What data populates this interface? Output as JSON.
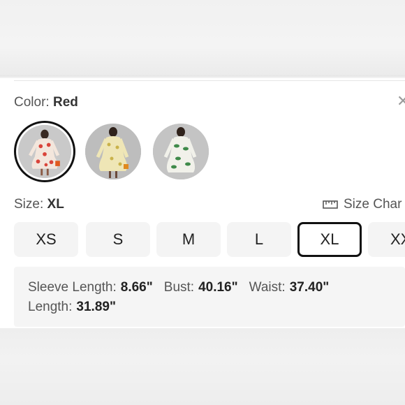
{
  "color": {
    "label": "Color:",
    "value": "Red"
  },
  "swatches": [
    {
      "name": "Red",
      "selected": true
    },
    {
      "name": "Yellow",
      "selected": false
    },
    {
      "name": "Green",
      "selected": false
    }
  ],
  "close_icon": "close-icon",
  "size": {
    "label": "Size:",
    "value": "XL",
    "guide_label": "Size Char",
    "guide_icon": "ruler-icon"
  },
  "sizes": [
    "XS",
    "S",
    "M",
    "L",
    "XL",
    "XX"
  ],
  "selected_size": "XL",
  "measurements": {
    "sleeve_label": "Sleeve Length:",
    "sleeve_value": "8.66\"",
    "bust_label": "Bust:",
    "bust_value": "40.16\"",
    "waist_label": "Waist:",
    "waist_value": "37.40\"",
    "length_label": "Length:",
    "length_value": "31.89\""
  },
  "colors": {
    "selected_border": "#111111",
    "button_bg": "#f4f4f4",
    "text": "#555555"
  }
}
